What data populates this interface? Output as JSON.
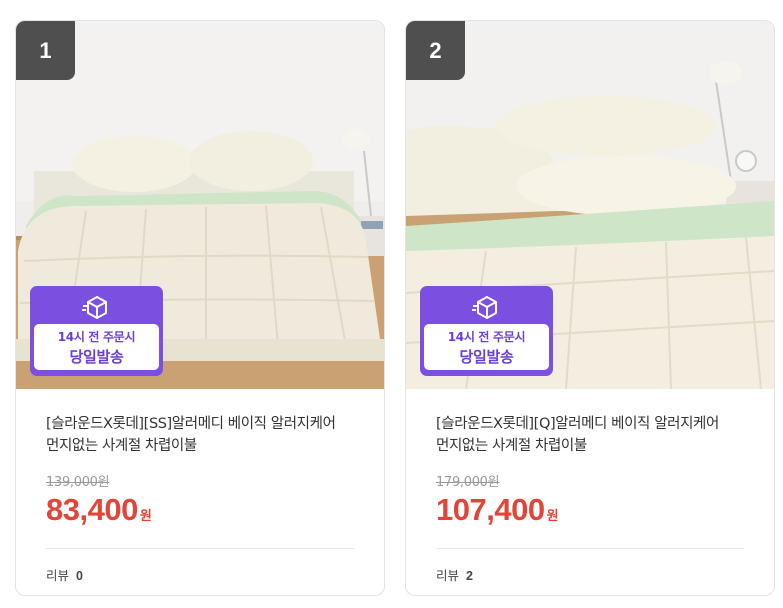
{
  "products": [
    {
      "rank": "1",
      "badge": {
        "line1": "14시 전 주문시",
        "line2": "당일발송"
      },
      "title": "[슬라운드X롯데][SS]알러메디 베이직 알러지케어 먼지없는 사계절 차렵이불",
      "original_price": "139,000원",
      "price": "83,400",
      "currency": "원",
      "review_label": "리뷰",
      "review_count": "0"
    },
    {
      "rank": "2",
      "badge": {
        "line1": "14시 전 주문시",
        "line2": "당일발송"
      },
      "title": "[슬라운드X롯데][Q]알러메디 베이직 알러지케어 먼지없는 사계절 차렵이불",
      "original_price": "179,000원",
      "price": "107,400",
      "currency": "원",
      "review_label": "리뷰",
      "review_count": "2"
    }
  ],
  "colors": {
    "price_red": "#e14538",
    "badge_purple": "#7b4fe0",
    "rank_bg": "#4f4f4f"
  },
  "icons": [
    "delivery-box-icon"
  ]
}
